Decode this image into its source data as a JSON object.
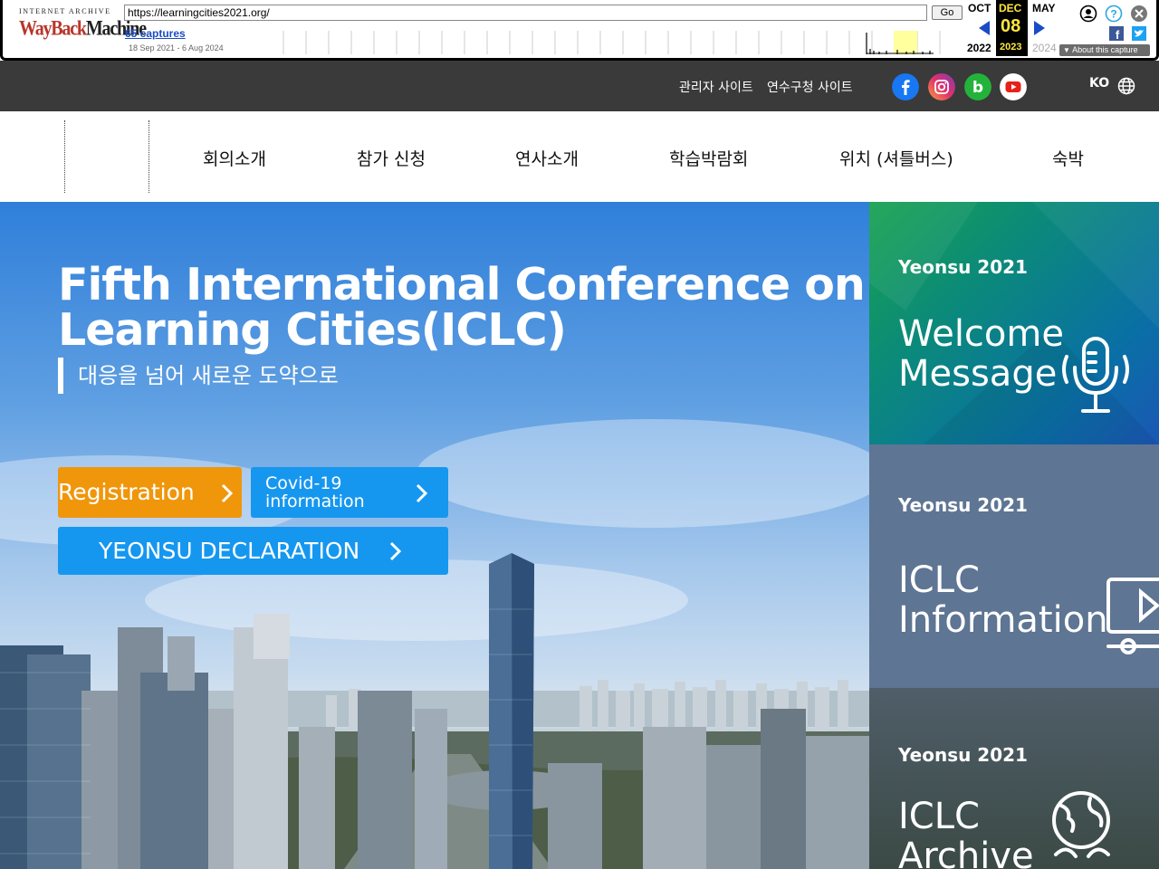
{
  "wayback": {
    "logo_top": "INTERNET ARCHIVE",
    "logo_wayback": "WayBack",
    "logo_machine": "Machine",
    "url": "https://learningcities2021.org/",
    "go_label": "Go",
    "captures": "65 captures",
    "date_range": "18 Sep 2021 - 6 Aug 2024",
    "prev_month": "OCT",
    "cur_month": "DEC",
    "next_month": "MAY",
    "cur_day": "08",
    "prev_year": "2022",
    "cur_year": "2023",
    "next_year": "2024",
    "about": "About this capture"
  },
  "topbar": {
    "admin_link": "관리자 사이트",
    "yeonsu_link": "연수구청 사이트",
    "lang": "KO",
    "social": [
      "facebook-icon",
      "instagram-icon",
      "blog-icon",
      "youtube-icon"
    ]
  },
  "nav": {
    "items": [
      "회의소개",
      "참가 신청",
      "연사소개",
      "학습박람회",
      "위치 (셔틀버스)",
      "숙박"
    ]
  },
  "hero": {
    "title_line1": "Fifth International Conference on",
    "title_line2": "Learning Cities(ICLC)",
    "subtitle": "대응을 넘어 새로운 도약으로",
    "registration": "Registration",
    "covid_line1": "Covid-19",
    "covid_line2": "information",
    "declaration": "YEONSU DECLARATION"
  },
  "panels": [
    {
      "tag": "Yeonsu 2021",
      "title_line1": "Welcome",
      "title_line2": "Message",
      "icon": "microphone-icon"
    },
    {
      "tag": "Yeonsu 2021",
      "title_line1": "ICLC",
      "title_line2": "Information",
      "icon": "video-player-icon"
    },
    {
      "tag": "Yeonsu 2021",
      "title_line1": "ICLC",
      "title_line2": "Archive",
      "icon": "globe-people-icon"
    }
  ],
  "colors": {
    "topbar": "#3a3a3a",
    "registration": "#f0960b",
    "accent_blue": "#1697ef",
    "panel_green": "#18a24f",
    "panel_slate": "#5e7593"
  }
}
